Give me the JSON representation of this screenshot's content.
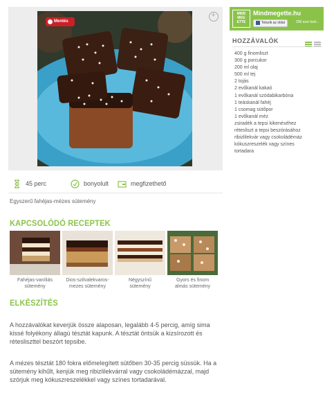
{
  "photo": {
    "pin_label": "Mentés"
  },
  "meta": {
    "time": "45 perc",
    "difficulty": "bonyolult",
    "price": "megfizethető"
  },
  "description": "Egyszerű fahéjas-mézes sütemény",
  "related": {
    "title": "KAPCSOLÓDÓ RECEPTEK",
    "items": [
      {
        "line1": "Fahéjas-vaníliás",
        "line2": "sütemény"
      },
      {
        "line1": "Dios-szilvalekvaros-",
        "line2": "mezes sütemény"
      },
      {
        "line1": "Négyszínű",
        "line2": "sütemény"
      },
      {
        "line1": "Gyors és finom",
        "line2": "almás sütemény"
      }
    ]
  },
  "preparation": {
    "title": "ELKÉSZÍTÉS",
    "paragraphs": [
      "A hozzávalókat keverjük össze alaposan, legalább 4-5 percig, amíg sima kissé folyékony állagú tésztát kapunk. A tésztát öntsük a kizsírozott és rétesliszttel beszórt tepsibe.",
      "A mézes tésztát 180 fokra előmelegített sütőben 30-35 percig süssük. Ha a sütemény kihűlt, kenjük meg ribizlilekvárral vagy csokoládémázzal, majd szórjuk meg kókuszreszelékkel vagy színes tortadarával."
    ]
  },
  "sidebar": {
    "brand_logo_lines": [
      "MIND",
      "MEG",
      "ETTE"
    ],
    "brand_name": "Mindmegette.hu",
    "like_button": "Tetszik az oldal",
    "like_count": "296 ezer ked...",
    "ingredients_title": "HOZZÁVALÓK",
    "ingredients": [
      "400 g finomliszt",
      "300 g porcukor",
      "200 ml olaj",
      "500 ml tej",
      "2 tojás",
      "2 evőkanál kakaó",
      "1 evőkanál szódabikarbóna",
      "1 teáskanál fahéj",
      "1 csomag sütőpor",
      "1 evőkanál méz",
      "zsiradék a tepsi kikenéséhez",
      "rétesliszt a tepsi beszórásához",
      "ribizlilekvár vagy csokoládémáz",
      "kókuszreszelék vagy színes",
      "tortadara"
    ]
  },
  "colors": {
    "accent": "#8bc34a",
    "pinterest": "#cb2027"
  }
}
